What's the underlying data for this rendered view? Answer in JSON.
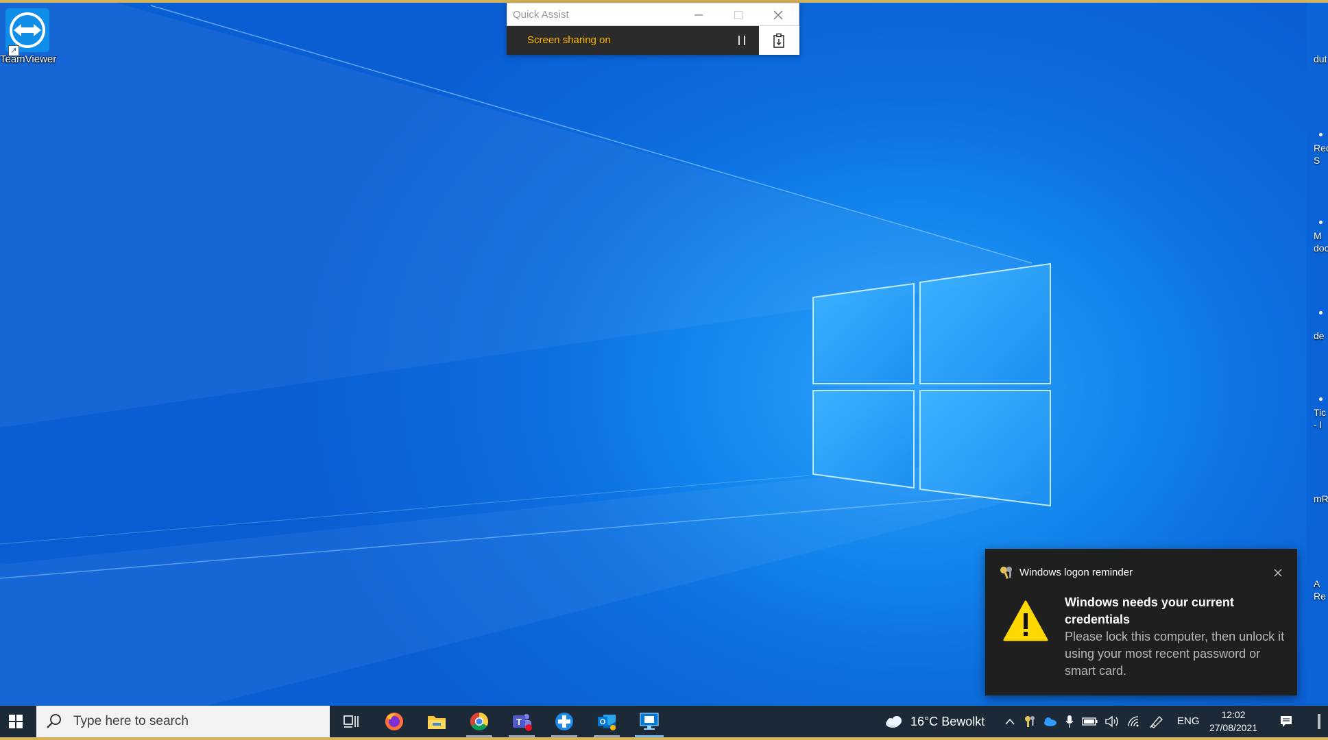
{
  "desktop": {
    "icons": [
      {
        "label": "TeamViewer"
      }
    ],
    "right_edge_labels": [
      "dut",
      "Rec",
      "S",
      "M",
      "doc",
      "de",
      "Tic",
      "- l",
      "mR",
      "A",
      "Re"
    ]
  },
  "quick_assist": {
    "title": "Quick Assist",
    "status": "Screen sharing on",
    "status_color": "#ffb900"
  },
  "toast": {
    "app_name": "Windows logon reminder",
    "title": "Windows needs your current credentials",
    "body": "Please lock this computer, then unlock it using your most recent password or smart card."
  },
  "taskbar": {
    "search_placeholder": "Type here to search",
    "pinned": [
      "task-view-icon",
      "firefox-icon",
      "file-explorer-icon",
      "chrome-icon",
      "teams-icon",
      "quick-assist-icon",
      "outlook-icon",
      "remote-desktop-icon"
    ],
    "weather": "16°C Bewolkt",
    "language": "ENG",
    "time": "12:02",
    "date": "27/08/2021"
  },
  "colors": {
    "taskbar": "#1c2a38",
    "accent": "#0078d7",
    "frame": "#d4b35a"
  }
}
